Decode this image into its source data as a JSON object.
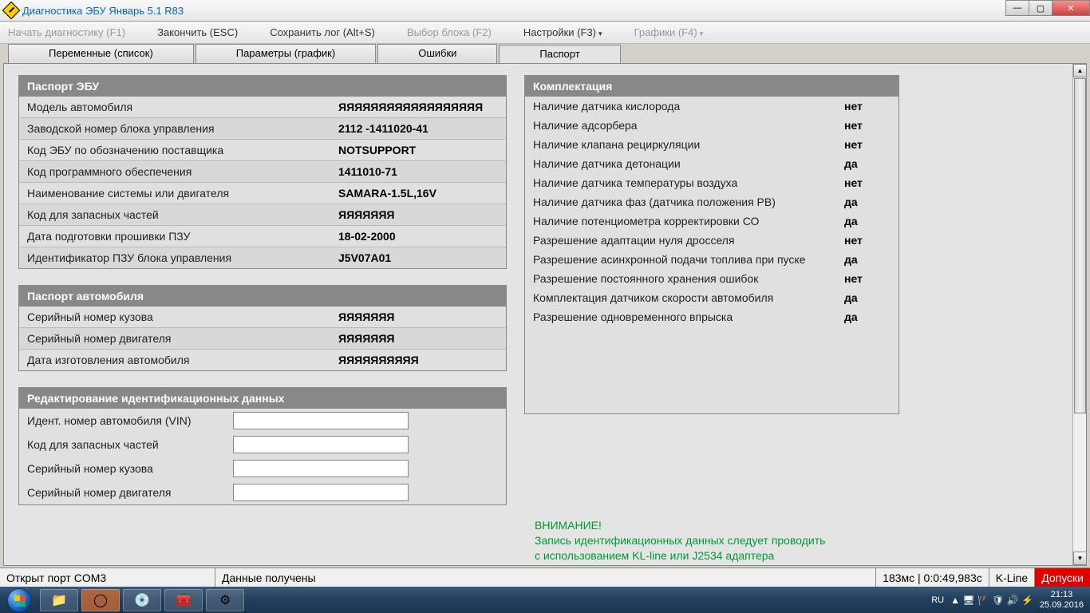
{
  "window": {
    "title": "Диагностика ЭБУ Январь 5.1 R83"
  },
  "menu": {
    "start": "Начать диагностику (F1)",
    "end": "Закончить (ESC)",
    "save_log": "Сохранить лог (Alt+S)",
    "select_block": "Выбор блока (F2)",
    "settings": "Настройки (F3)",
    "charts": "Графики (F4)"
  },
  "tabs": {
    "vars": "Переменные (список)",
    "params": "Параметры (график)",
    "errors": "Ошибки",
    "passport": "Паспорт"
  },
  "ecu_passport": {
    "header": "Паспорт ЭБУ",
    "rows": [
      {
        "label": "Модель автомобиля",
        "value": "ЯЯЯЯЯЯЯЯЯЯЯЯЯЯЯЯЯЯ"
      },
      {
        "label": "Заводской номер блока управления",
        "value": "2112 -1411020-41"
      },
      {
        "label": "Код ЭБУ по обозначению поставщика",
        "value": "NOTSUPPORT"
      },
      {
        "label": "Код программного обеспечения",
        "value": "1411010-71"
      },
      {
        "label": "Наименование системы или двигателя",
        "value": "SAMARA-1.5L,16V"
      },
      {
        "label": "Код для запасных частей",
        "value": "ЯЯЯЯЯЯЯ"
      },
      {
        "label": "Дата подготовки прошивки ПЗУ",
        "value": "18-02-2000"
      },
      {
        "label": "Идентификатор ПЗУ блока управления",
        "value": "J5V07A01"
      }
    ]
  },
  "car_passport": {
    "header": "Паспорт автомобиля",
    "rows": [
      {
        "label": "Серийный номер кузова",
        "value": "ЯЯЯЯЯЯЯ"
      },
      {
        "label": "Серийный номер двигателя",
        "value": "ЯЯЯЯЯЯЯ"
      },
      {
        "label": "Дата изготовления автомобиля",
        "value": "ЯЯЯЯЯЯЯЯЯЯ"
      }
    ]
  },
  "equipment": {
    "header": "Комплектация",
    "rows": [
      {
        "label": "Наличие датчика кислорода",
        "value": "нет"
      },
      {
        "label": "Наличие адсорбера",
        "value": "нет"
      },
      {
        "label": "Наличие клапана рециркуляции",
        "value": "нет"
      },
      {
        "label": "Наличие датчика детонации",
        "value": "да"
      },
      {
        "label": "Наличие датчика температуры воздуха",
        "value": "нет"
      },
      {
        "label": "Наличие датчика фаз (датчика положения РВ)",
        "value": "да"
      },
      {
        "label": "Наличие потенциометра корректировки СО",
        "value": "да"
      },
      {
        "label": "Разрешение адаптации нуля дросселя",
        "value": "нет"
      },
      {
        "label": "Разрешение асинхронной подачи топлива при пуске",
        "value": "да"
      },
      {
        "label": "Разрешение постоянного хранения ошибок",
        "value": "нет"
      },
      {
        "label": "Комплектация датчиком скорости автомобиля",
        "value": "да"
      },
      {
        "label": "Разрешение одновременного впрыска",
        "value": "да"
      }
    ]
  },
  "edit": {
    "header": "Редактирование идентификационных данных",
    "fields": [
      {
        "label": "Идент. номер автомобиля (VIN)",
        "value": ""
      },
      {
        "label": "Код для запасных частей",
        "value": ""
      },
      {
        "label": "Серийный номер кузова",
        "value": ""
      },
      {
        "label": "Серийный номер двигателя",
        "value": ""
      }
    ]
  },
  "warning": {
    "title": "ВНИМАНИЕ!",
    "line1": "Запись идентификационных данных следует проводить",
    "line2": "с использованием KL-line или J2534 адаптера"
  },
  "status": {
    "port": "Открыт порт COM3",
    "data": "Данные получены",
    "timing": "183мс | 0:0:49,983с",
    "mode": "K-Line",
    "tolerance": "Допуски"
  },
  "tray": {
    "lang": "RU",
    "time": "21:13",
    "date": "25.09.2016"
  }
}
